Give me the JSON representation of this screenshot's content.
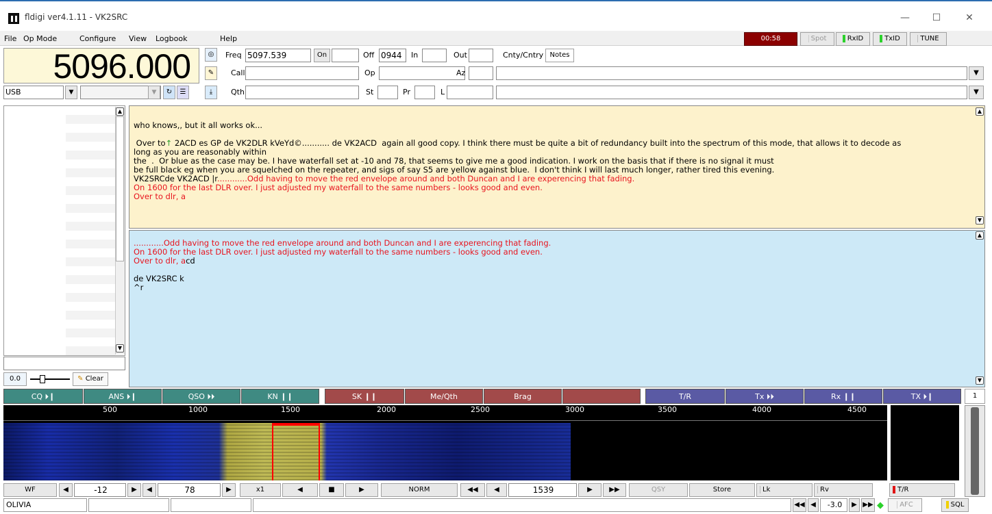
{
  "window": {
    "title": "fldigi ver4.1.11 - VK2SRC",
    "minimize": "—",
    "maximize": "☐",
    "close": "✕"
  },
  "menu": {
    "file": "File",
    "opmode": "Op Mode",
    "configure": "Configure",
    "view": "View",
    "logbook": "Logbook",
    "help": "Help"
  },
  "status_buttons": {
    "timer": "00:58",
    "spot": "Spot",
    "rxid": "RxID",
    "txid": "TxID",
    "tune": "TUNE"
  },
  "freq": {
    "display": "5096.000",
    "mode": "USB"
  },
  "log": {
    "freq_label": "Freq",
    "freq_value": "5097.539",
    "on_label": "On",
    "on_value": "",
    "off_label": "Off",
    "off_value": "0944",
    "in_label": "In",
    "in_value": "",
    "out_label": "Out",
    "out_value": "",
    "cnty_tab": "Cnty/Cntry",
    "notes_tab": "Notes",
    "call_label": "Call",
    "call_value": "",
    "op_label": "Op",
    "op_value": "",
    "az_label": "Az",
    "az_value": "",
    "qth_label": "Qth",
    "qth_value": "",
    "st_label": "St",
    "st_value": "",
    "pr_label": "Pr",
    "pr_value": "",
    "l_label": "L",
    "l_value": ""
  },
  "rx_text": {
    "line1": "who knows,, but it all works ok...",
    "line2": " Over to",
    "line2_arrow": "↑",
    "line2b": " 2ACD es GP de VK2DLR kVeYd©........... de VK2ACD  again all good copy. I think there must be quite a bit of redundancy built into the spectrum of this mode, that allows it to decode as",
    "line3": "long as you are reasonably within",
    "line4": "the  .  Or blue as the case may be. I have waterfall set at -10 and 78, that seems to give me a good indication. I work on the basis that if there is no signal it must",
    "line5": "be full black eg when you are squelched on the repeater, and sigs of say S5 are yellow against blue.  I don't think I will last much longer, rather tired this evening.",
    "line6": "VK2SRCde VK2ACD |r",
    "line6_red": "............Odd having to move the red envelope around and both Duncan and I are experencing that fading.",
    "line7_red": "On 1600 for the last DLR over. I just adjusted my waterfall to the same numbers - looks good and even.",
    "line8_red": "Over to dlr, a"
  },
  "tx_text": {
    "line1_red": "............Odd having to move the red envelope around and both Duncan and I are experencing that fading.",
    "line2_red": "On 1600 for the last DLR over. I just adjusted my waterfall to the same numbers - looks good and even.",
    "line3_red": "Over to dlr, a",
    "line3_black": "cd",
    "line4": "de VK2SRC k",
    "line5": "^r"
  },
  "left_panel": {
    "value": "0.0",
    "clear": "Clear"
  },
  "macros": [
    "CQ ⏵❙",
    "ANS ⏵❙",
    "QSO ⏵⏵",
    "KN ❙❙",
    "SK ❙❙",
    "Me/Qth",
    "Brag",
    "",
    "T/R",
    "Tx ⏵⏵",
    "Rx ❙❙",
    "TX ⏵❙"
  ],
  "macro_page": "1",
  "ruler": [
    "500",
    "1000",
    "1500",
    "2000",
    "2500",
    "3000",
    "3500",
    "4000",
    "4500"
  ],
  "controls": {
    "wf": "WF",
    "ref_level": "-12",
    "range": "78",
    "zoom": "x1",
    "norm": "NORM",
    "freq": "1539",
    "qsy": "QSY",
    "store": "Store",
    "lk": "Lk",
    "rv": "Rv",
    "tr": "T/R"
  },
  "status_bar": {
    "mode": "OLIVIA",
    "s2n": "-3.0",
    "afc": "AFC",
    "sql": "SQL"
  },
  "colors": {
    "macro_teal": "#3f8a82",
    "macro_brown": "#a24a4a",
    "macro_blue": "#5a5aa4",
    "rx_bg": "#fdf2cc",
    "tx_bg": "#cde9f7",
    "red_text": "#e8141e"
  }
}
